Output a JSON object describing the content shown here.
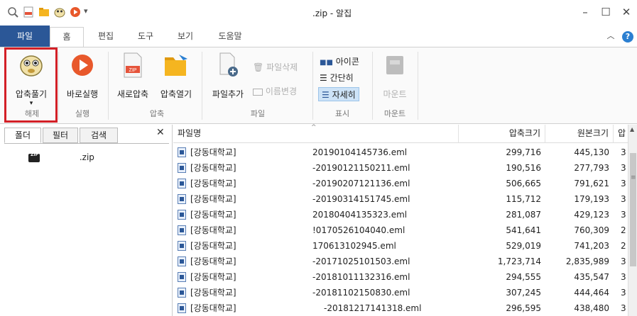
{
  "window": {
    "title": ".zip - 알집",
    "controls": {
      "minimize": "–",
      "maximize": "☐",
      "close": "✕"
    }
  },
  "quick_access": {
    "customize_arrow": "▾"
  },
  "tabs": [
    {
      "label": "파일"
    },
    {
      "label": "홈"
    },
    {
      "label": "편집"
    },
    {
      "label": "도구"
    },
    {
      "label": "보기"
    },
    {
      "label": "도움말"
    }
  ],
  "tab_right": {
    "collapse": "︿",
    "help": "?"
  },
  "ribbon": {
    "extract": {
      "label": "압축풀기",
      "dropdown": "▾"
    },
    "run": {
      "label": "바로실행"
    },
    "new_archive": {
      "label": "새로압축"
    },
    "open_archive": {
      "label": "압축열기"
    },
    "add_file": {
      "label": "파일추가"
    },
    "delete_file": {
      "label": "파일삭제"
    },
    "rename": {
      "label": "이름변경"
    },
    "view_icon": {
      "label": "아이콘"
    },
    "view_simple": {
      "label": "간단히"
    },
    "view_detail": {
      "label": "자세히"
    },
    "mount": {
      "label": "마운트"
    },
    "groups": {
      "extract": "해제",
      "run": "실행",
      "compress": "압축",
      "file": "파일",
      "display": "표시",
      "mount": "마운트"
    }
  },
  "left_panel": {
    "tabs": [
      "폴더",
      "필터",
      "검색"
    ],
    "close": "✕",
    "tree": {
      "name": ".zip"
    }
  },
  "file_list": {
    "columns": [
      "파일명",
      "압축크기",
      "원본크기",
      "압축"
    ],
    "rows": [
      {
        "name": "[강동대학교]",
        "suffix": "20190104145736.eml",
        "packed": "299,716",
        "original": "445,130",
        "ratio": "3"
      },
      {
        "name": "[강동대학교]",
        "suffix": "-20190121150211.eml",
        "packed": "190,516",
        "original": "277,793",
        "ratio": "3"
      },
      {
        "name": "[강동대학교]",
        "suffix": "-20190207121136.eml",
        "packed": "506,665",
        "original": "791,621",
        "ratio": "3"
      },
      {
        "name": "[강동대학교]",
        "suffix": "-20190314151745.eml",
        "packed": "115,712",
        "original": "179,193",
        "ratio": "3"
      },
      {
        "name": "[강동대학교]",
        "suffix": "20180404135323.eml",
        "packed": "281,087",
        "original": "429,123",
        "ratio": "3"
      },
      {
        "name": "[강동대학교]",
        "suffix": "!0170526104040.eml",
        "packed": "541,641",
        "original": "760,309",
        "ratio": "2"
      },
      {
        "name": "[강동대학교]",
        "suffix": "170613102945.eml",
        "packed": "529,019",
        "original": "741,203",
        "ratio": "2"
      },
      {
        "name": "[강동대학교]",
        "suffix": "-20171025101503.eml",
        "packed": "1,723,714",
        "original": "2,835,989",
        "ratio": "3"
      },
      {
        "name": "[강동대학교]",
        "suffix": "-20181011132316.eml",
        "packed": "294,555",
        "original": "435,547",
        "ratio": "3"
      },
      {
        "name": "[강동대학교]",
        "suffix": "-20181102150830.eml",
        "packed": "307,245",
        "original": "444,464",
        "ratio": "3"
      },
      {
        "name": "[강동대학교]",
        "suffix": "-20181217141318.eml",
        "packed": "296,595",
        "original": "438,480",
        "ratio": "3"
      }
    ]
  },
  "colors": {
    "file_tab": "#2b5797",
    "highlight": "#d32027",
    "run_icon": "#e8582b",
    "folder_icon": "#f5b520"
  }
}
